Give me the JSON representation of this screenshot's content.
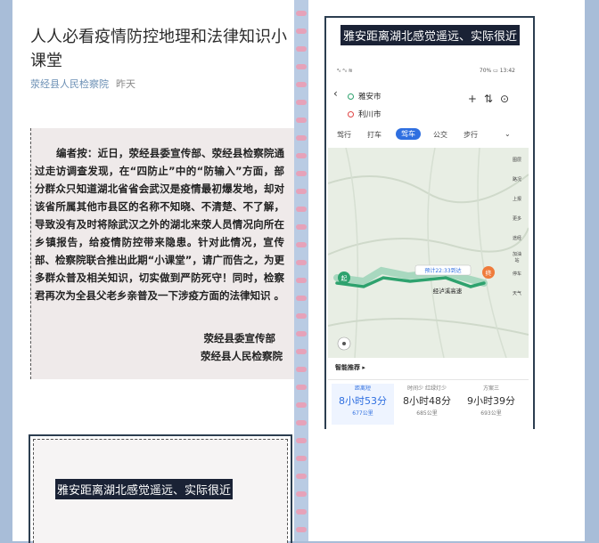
{
  "article": {
    "title": "人人必看疫情防控地理和法律知识小课堂",
    "source": "荥经县人民检察院",
    "time": "昨天",
    "notice_body": "编者按：近日，荥经县委宣传部、荥经县检察院通过走访调查发现，在“四防止”中的“防输入”方面，部分群众只知道湖北省省会武汉是疫情最初爆发地，却对该省所属其他市县区的名称不知晓、不清楚、不了解，导致没有及时将除武汉之外的湖北来荥人员情况向所在乡镇报告，给疫情防控带来隐患。针对此情况，宣传部、检察院联合推出此期“小课堂”，请广而告之，为更多群众普及相关知识，切实做到严防死守！同时，检察君再次为全县父老乡亲普及一下涉疫方面的法律知识 。",
    "signature_1": "荥经县委宣传部",
    "signature_2": "荥经县人民检察院",
    "card_caption": "雅安距离湖北感觉遥远、实际很近"
  },
  "map_card": {
    "caption": "雅安距离湖北感觉遥远、实际很近",
    "status_left": "ᵃᵢₗ ᵃᵢₗ ≋",
    "status_right": "70% ▭ 13:42",
    "from": "雅安市",
    "to": "利川市",
    "modes": [
      "驾行",
      "打车",
      "驾车",
      "公交",
      "步行"
    ],
    "map_labels": {
      "start": "起",
      "end": "终",
      "eta": "预计22:33到达",
      "via": "经泸溪高速"
    },
    "side_tools": [
      "图层",
      "路况",
      "上报",
      "更多",
      "途经",
      "加油站",
      "停车",
      "天气"
    ],
    "smart_label": "智能推荐 ▸",
    "plans": [
      {
        "label": "距离短",
        "duration": "8小时53分",
        "distance": "677公里"
      },
      {
        "label": "时间少 红绿灯少",
        "duration": "8小时48分",
        "distance": "685公里"
      },
      {
        "label": "方案三",
        "duration": "9小时39分",
        "distance": "693公里"
      }
    ]
  },
  "colors": {
    "background": "#a8bdd8",
    "ring": "#e6a2b9",
    "caption_bg": "#1a2235",
    "route": "#2ea26e",
    "drive_mode": "#2f6fe0"
  }
}
